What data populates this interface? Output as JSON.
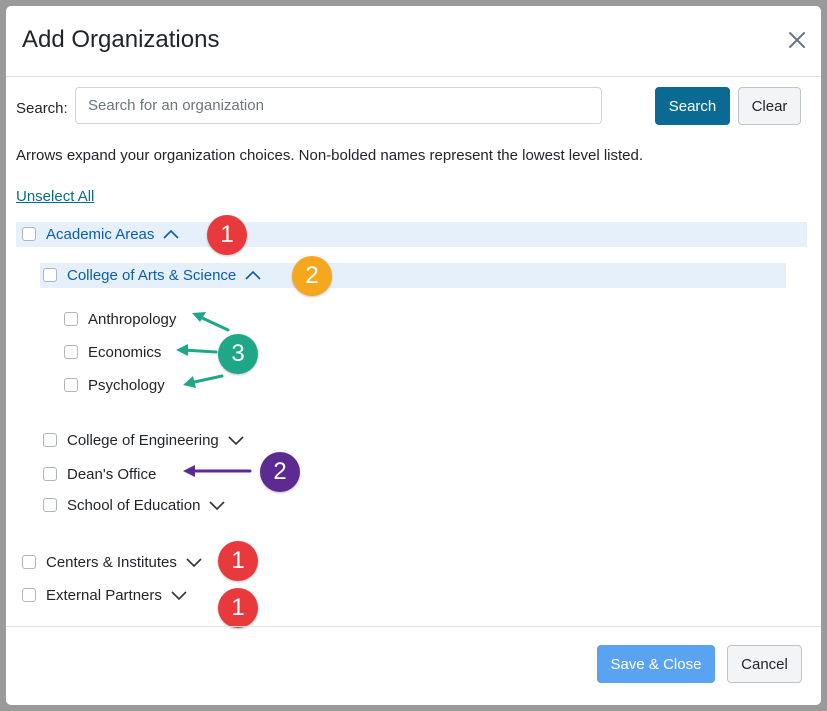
{
  "modal": {
    "title": "Add Organizations",
    "close_icon": "close-icon"
  },
  "search": {
    "label": "Search:",
    "placeholder": "Search for an organization",
    "value": "",
    "search_button": "Search",
    "clear_button": "Clear"
  },
  "hint": "Arrows expand your organization choices. Non-bolded names represent the lowest level listed.",
  "unselect_all": "Unselect All",
  "tree": {
    "academic_areas": "Academic Areas",
    "college_arts_science": "College of Arts & Science",
    "anthropology": "Anthropology",
    "economics": "Economics",
    "psychology": "Psychology",
    "college_engineering": "College of Engineering",
    "deans_office": "Dean's Office",
    "school_education": "School of Education",
    "centers_institutes": "Centers & Institutes",
    "external_partners": "External Partners"
  },
  "callouts": {
    "academic_areas": "1",
    "college_arts_science": "2",
    "leaf_items": "3",
    "deans_office": "2",
    "centers_institutes": "1",
    "external_partners": "1"
  },
  "colors": {
    "primary": "#0a6a93",
    "link": "#0d5cae",
    "highlight": "#e6f0fb",
    "badge_red": "#e8393c",
    "badge_orange": "#f5a71d",
    "badge_teal": "#1ea888",
    "badge_purple": "#5d2a91"
  },
  "footer": {
    "save_close": "Save & Close",
    "cancel": "Cancel"
  }
}
